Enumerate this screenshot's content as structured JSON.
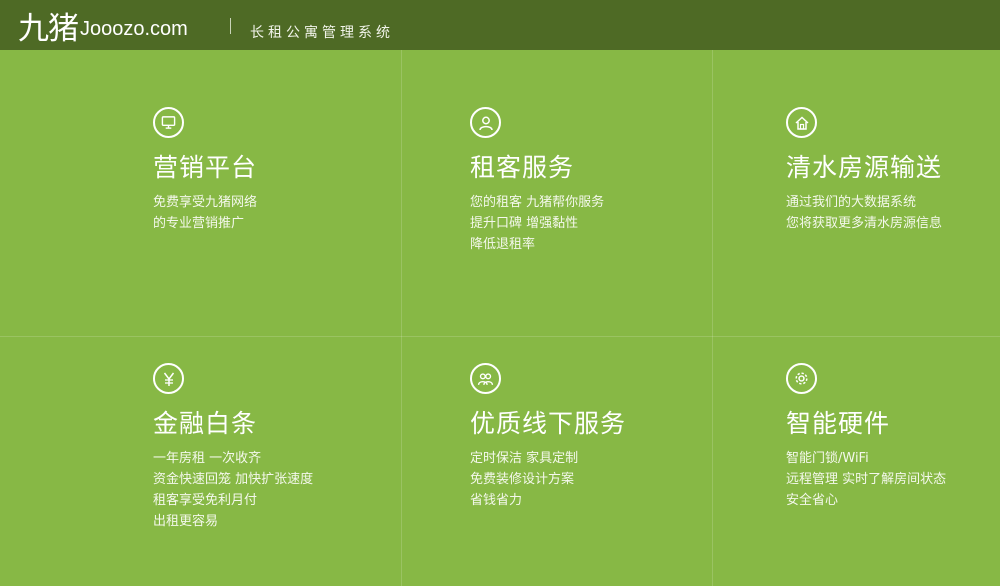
{
  "brand": {
    "logo_cn": "九猪",
    "logo_domain": "Jooozo.com",
    "subtitle": "长租公寓管理系统"
  },
  "colors": {
    "background": "#87b845",
    "header": "#4e6a25",
    "text": "#ffffff"
  },
  "features": [
    {
      "icon": "monitor-icon",
      "title": "营销平台",
      "lines": [
        "免费享受九猪网络",
        "的专业营销推广"
      ]
    },
    {
      "icon": "user-icon",
      "title": "租客服务",
      "lines": [
        "您的租客  九猪帮你服务",
        "提升口碑 增强黏性",
        "降低退租率"
      ]
    },
    {
      "icon": "house-icon",
      "title": "清水房源输送",
      "lines": [
        "通过我们的大数据系统",
        "您将获取更多清水房源信息"
      ]
    },
    {
      "icon": "yen-icon",
      "title": "金融白条",
      "lines": [
        "一年房租  一次收齐",
        "资金快速回笼  加快扩张速度",
        "租客享受免利月付",
        "出租更容易"
      ]
    },
    {
      "icon": "people-icon",
      "title": "优质线下服务",
      "lines": [
        "定时保洁  家具定制",
        "免费装修设计方案",
        "省钱省力"
      ]
    },
    {
      "icon": "gear-icon",
      "title": "智能硬件",
      "lines": [
        "智能门锁/WiFi",
        "远程管理  实时了解房间状态",
        "安全省心"
      ]
    }
  ]
}
